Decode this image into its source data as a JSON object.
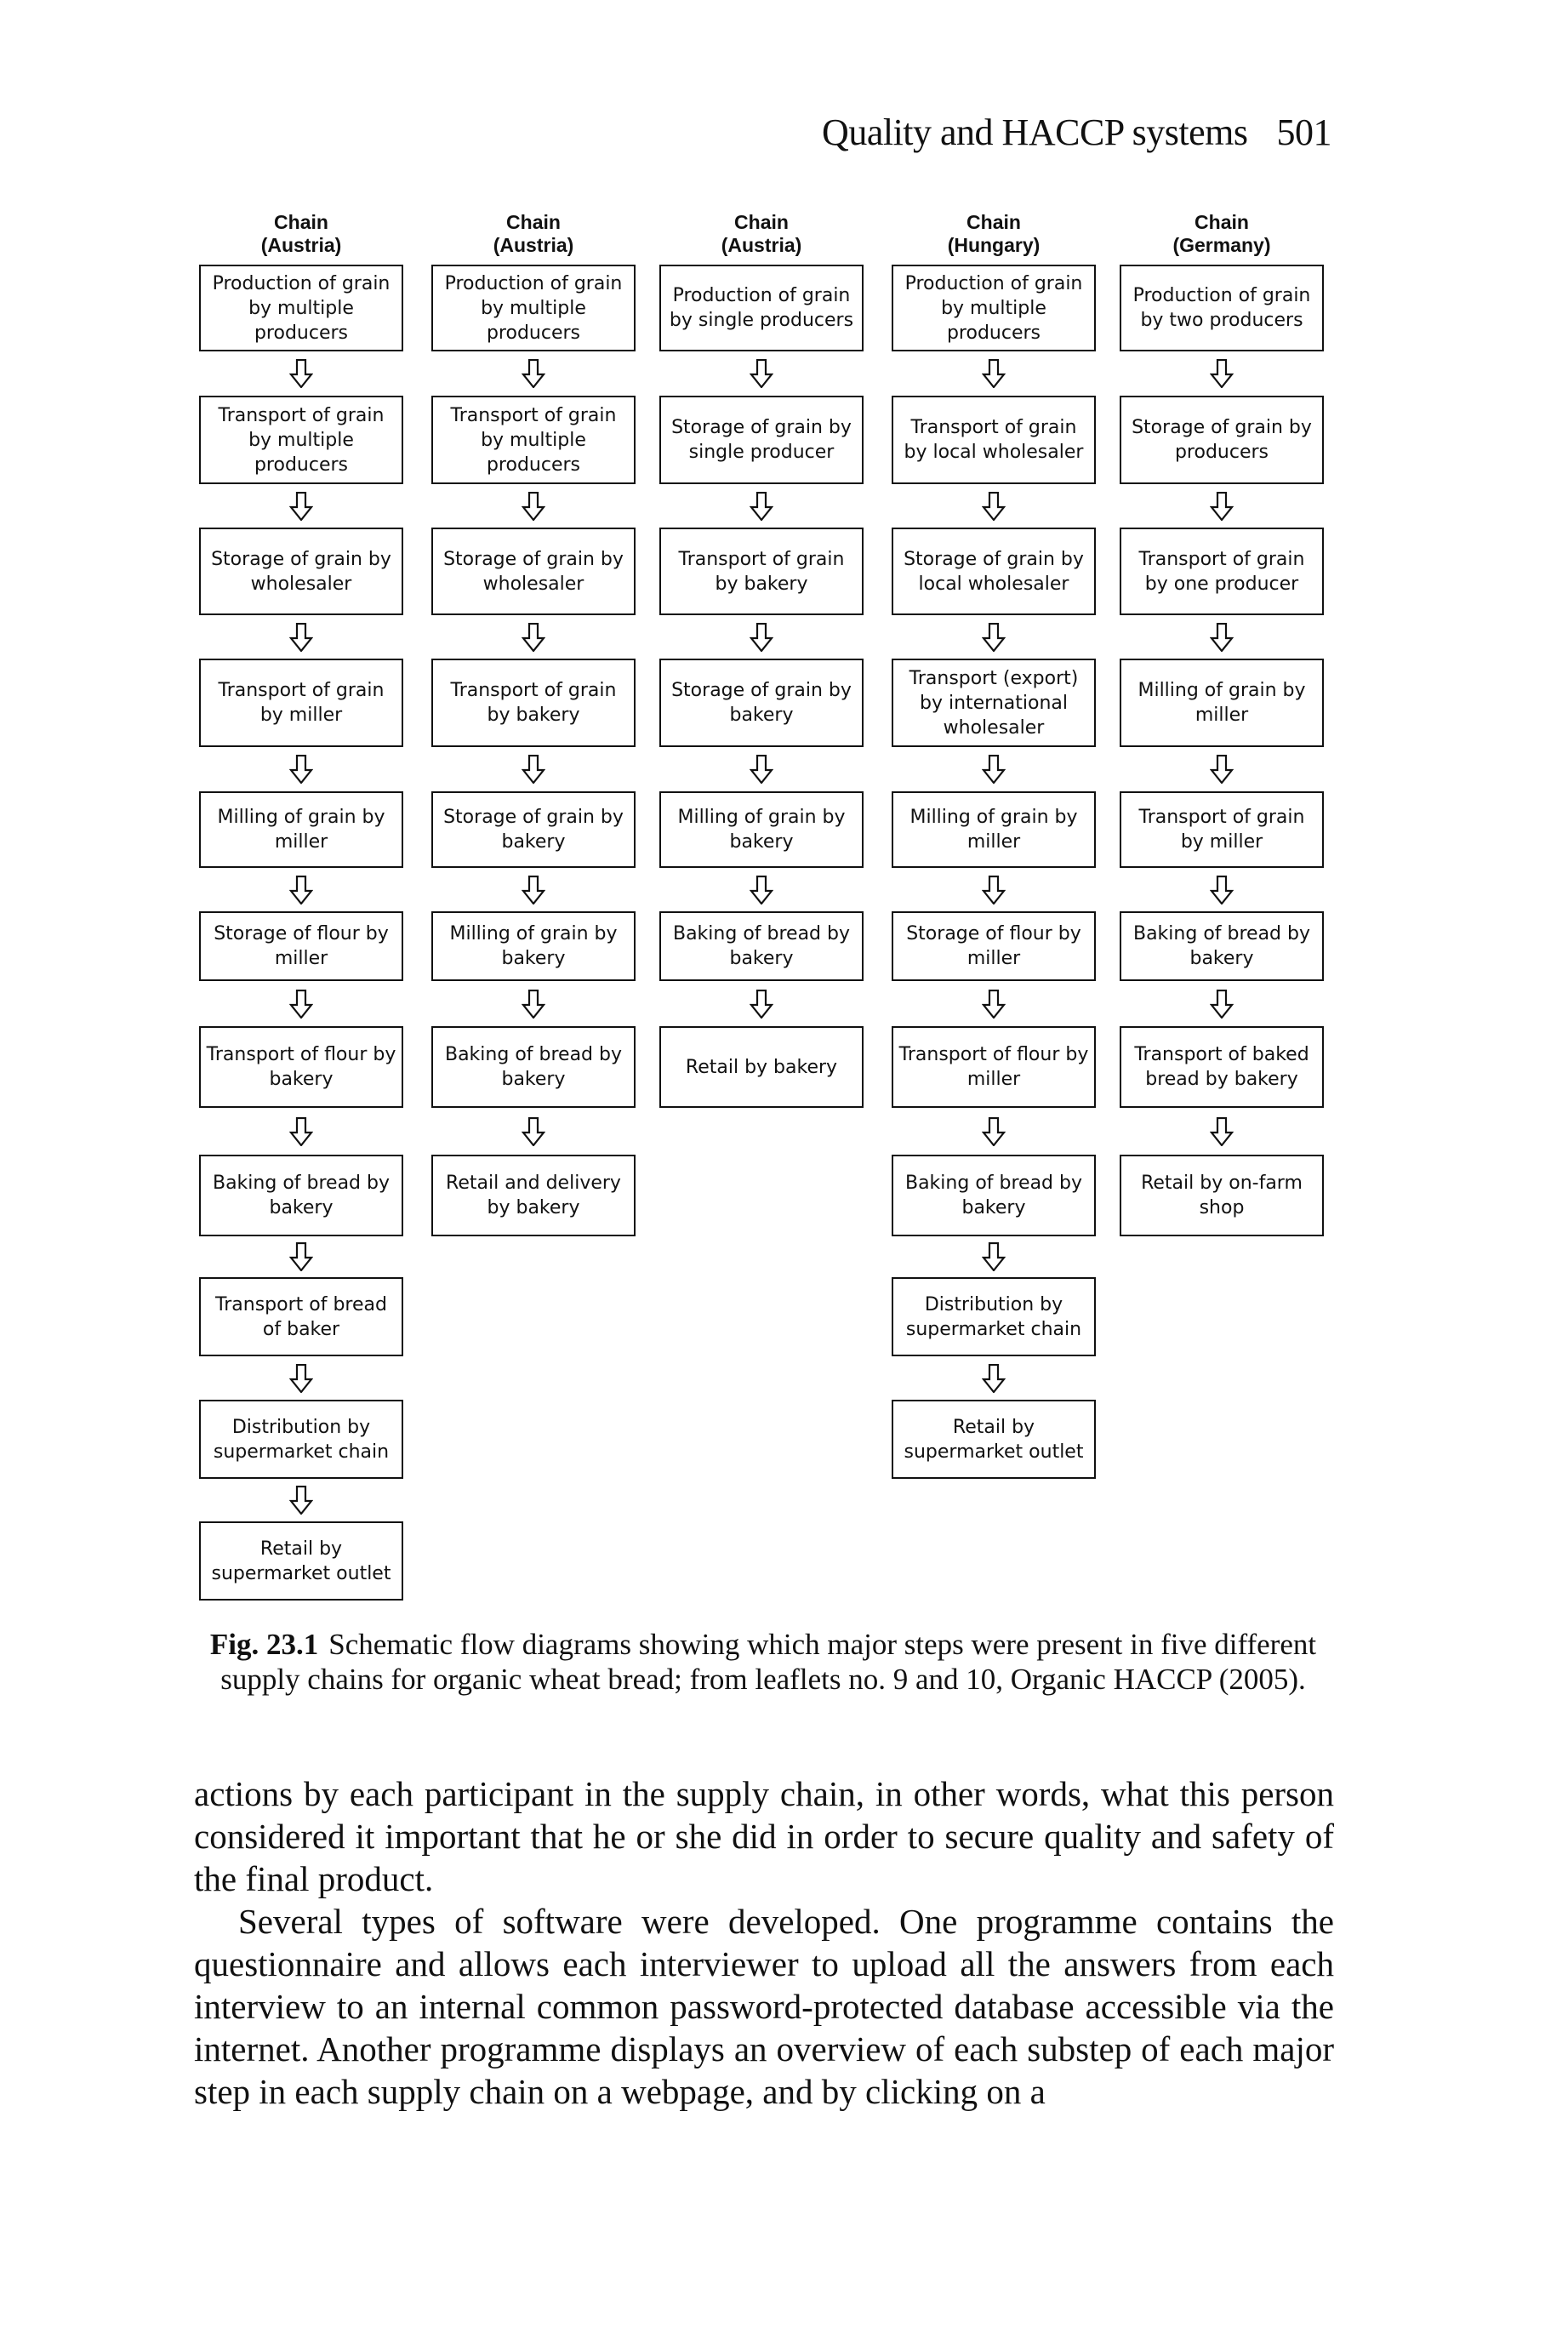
{
  "running_head": {
    "title": "Quality and HACCP systems",
    "page_number": "501"
  },
  "figure": {
    "chains": [
      {
        "label": "Chain",
        "country": "(Austria)",
        "steps": [
          "Production of grain by multiple producers",
          "Transport of grain by multiple producers",
          "Storage of grain by wholesaler",
          "Transport of grain by miller",
          "Milling of grain by miller",
          "Storage of flour by miller",
          "Transport of flour by bakery",
          "Baking of bread by bakery",
          "Transport of bread of baker",
          "Distribution by supermarket chain",
          "Retail by supermarket outlet"
        ]
      },
      {
        "label": "Chain",
        "country": "(Austria)",
        "steps": [
          "Production of grain by multiple producers",
          "Transport of grain by multiple producers",
          "Storage of grain by wholesaler",
          "Transport of grain by bakery",
          "Storage of grain by bakery",
          "Milling of grain by bakery",
          "Baking of bread by bakery",
          "Retail and delivery by bakery"
        ]
      },
      {
        "label": "Chain",
        "country": "(Austria)",
        "steps": [
          "Production of grain by single producers",
          "Storage of grain by single producer",
          "Transport of grain by bakery",
          "Storage of grain by bakery",
          "Milling of grain by bakery",
          "Baking of bread by bakery",
          "Retail by bakery"
        ]
      },
      {
        "label": "Chain",
        "country": "(Hungary)",
        "steps": [
          "Production of grain by multiple producers",
          "Transport of grain by local wholesaler",
          "Storage of grain by local wholesaler",
          "Transport (export) by international wholesaler",
          "Milling of grain by miller",
          "Storage of flour by miller",
          "Transport of flour by miller",
          "Baking of bread by bakery",
          "Distribution by supermarket chain",
          "Retail by supermarket outlet"
        ]
      },
      {
        "label": "Chain",
        "country": "(Germany)",
        "steps": [
          "Production of grain by two producers",
          "Storage of grain by producers",
          "Transport of grain by one producer",
          "Milling of grain by miller",
          "Transport of grain by miller",
          "Baking of bread by bakery",
          "Transport of baked bread by bakery",
          "Retail by on-farm shop"
        ]
      }
    ],
    "caption_label": "Fig. 23.1",
    "caption_text": "Schematic flow diagrams showing which major steps were present in five different supply chains for organic wheat bread; from leaflets no. 9 and 10, Organic HACCP (2005)."
  },
  "body": {
    "paragraphs": [
      "actions by each participant in the supply chain, in other words, what this person considered it important that he or she did in order to secure quality and safety of the final product.",
      "Several types of software were developed. One programme contains the questionnaire and allows each interviewer to upload all the answers from each interview to an internal common password-protected database accessible via the internet. Another programme displays an overview of each substep of each major step in each supply chain on a webpage, and by clicking on a"
    ]
  }
}
